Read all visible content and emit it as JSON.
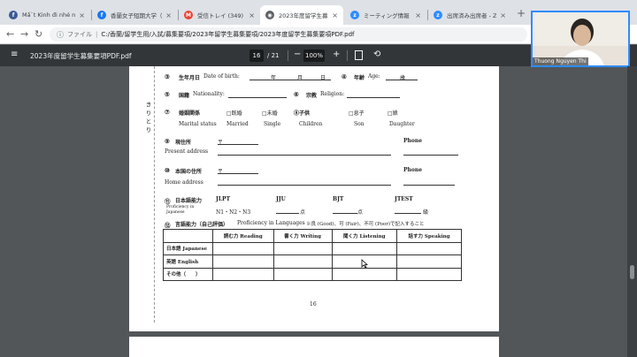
{
  "tabs": [
    {
      "title": "Mấ`t Kinh đi nhé nr...",
      "fav_color": "#3b5998",
      "fav_glyph": "f"
    },
    {
      "title": "香蘭女子短期大学（鷹...",
      "fav_color": "#1877f2",
      "fav_glyph": "f"
    },
    {
      "title": "受信トレイ (349) - ngu...",
      "fav_color": "#ea4335",
      "fav_glyph": "M"
    },
    {
      "title": "2023年度留学生募集...",
      "fav_color": "#5f6368",
      "fav_glyph": "◉"
    },
    {
      "title": "ミーティング情報 - Zoom",
      "fav_color": "#2d8cff",
      "fav_glyph": "z"
    },
    {
      "title": "出席済み出席者 - Zoo...",
      "fav_color": "#2d8cff",
      "fav_glyph": "z"
    }
  ],
  "new_tab": "+",
  "address": {
    "prefix": "ファイル",
    "path": "C:/香蘭/留学生用/入試/募集要項/2023年留学生募集要項/2023年度留学生募集要項PDF.pdf"
  },
  "pdf_toolbar": {
    "title": "2023年度留学生募集要項PDF.pdf",
    "page_current": "16",
    "page_total": "/ 21",
    "zoom": "100%",
    "minus": "−",
    "plus": "+"
  },
  "video": {
    "participant": "Thuong Nguyen Thi"
  },
  "form": {
    "side_text": "きりとり",
    "r1_num": "③",
    "r1_label": "生年月日",
    "r1_en": "Date of birth:",
    "r1_year": "年",
    "r1_month": "月",
    "r1_day": "日",
    "r1b_num": "④",
    "r1b_label": "年齢",
    "r1b_en": "Age:",
    "r1b_unit": "歳",
    "r2_num": "⑤",
    "r2_label": "国籍",
    "r2_en": "Nationality:",
    "r2b_num": "⑥",
    "r2b_label": "宗教",
    "r2b_en": "Religion:",
    "r3_num": "⑦",
    "r3_label": "婚姻関係",
    "r3_married": "□既婚",
    "r3_single": "□未婚",
    "r3_children_label": "⑧子供",
    "r3_son": "□息子",
    "r3_daughter": "□娘",
    "r3_en": "Marital status",
    "r3_married_en": "Married",
    "r3_single_en": "Single",
    "r3_children_en": "Children",
    "r3_son_en": "Son",
    "r3_daughter_en": "Daughter",
    "r4_num": "⑨",
    "r4_label": "現住所",
    "r4_postal": "〒",
    "r4_phone": "Phone",
    "r4_en": "Present address",
    "r5_num": "⑩",
    "r5_label": "本国の住所",
    "r5_postal": "〒",
    "r5_phone": "Phone",
    "r5_en": "Home address",
    "r6_num": "⑪",
    "r6_label": "日本語能力",
    "r6_en1": "Proficiency in",
    "r6_en2": "Japanese",
    "r6_jlpt": "JLPT",
    "r6_jlpt_levels": "N1・N2・N3",
    "r6_jtu": "JJU",
    "r6_jtu_unit": "点",
    "r6_bjt": "BJT",
    "r6_bjt_unit": "点",
    "r6_jtest": "JTEST",
    "r6_jtest_unit": "級",
    "r7_num": "⑫",
    "r7_label": "言語能力（自己評価）",
    "r7_en": "Proficiency in Languages",
    "r7_note": "※良 (Good)、可 (Fair)、不可 (Poor)で記入すること",
    "table_headers": [
      "",
      "読む力 Reading",
      "書く力 Writing",
      "聞く力 Listening",
      "話す力 Speaking"
    ],
    "table_rows": [
      [
        "日本語 Japanese",
        "",
        "",
        "",
        ""
      ],
      [
        "英語 English",
        "",
        "",
        "",
        ""
      ],
      [
        "その他（　　）",
        "",
        "",
        "",
        ""
      ]
    ],
    "page_number": "16"
  }
}
